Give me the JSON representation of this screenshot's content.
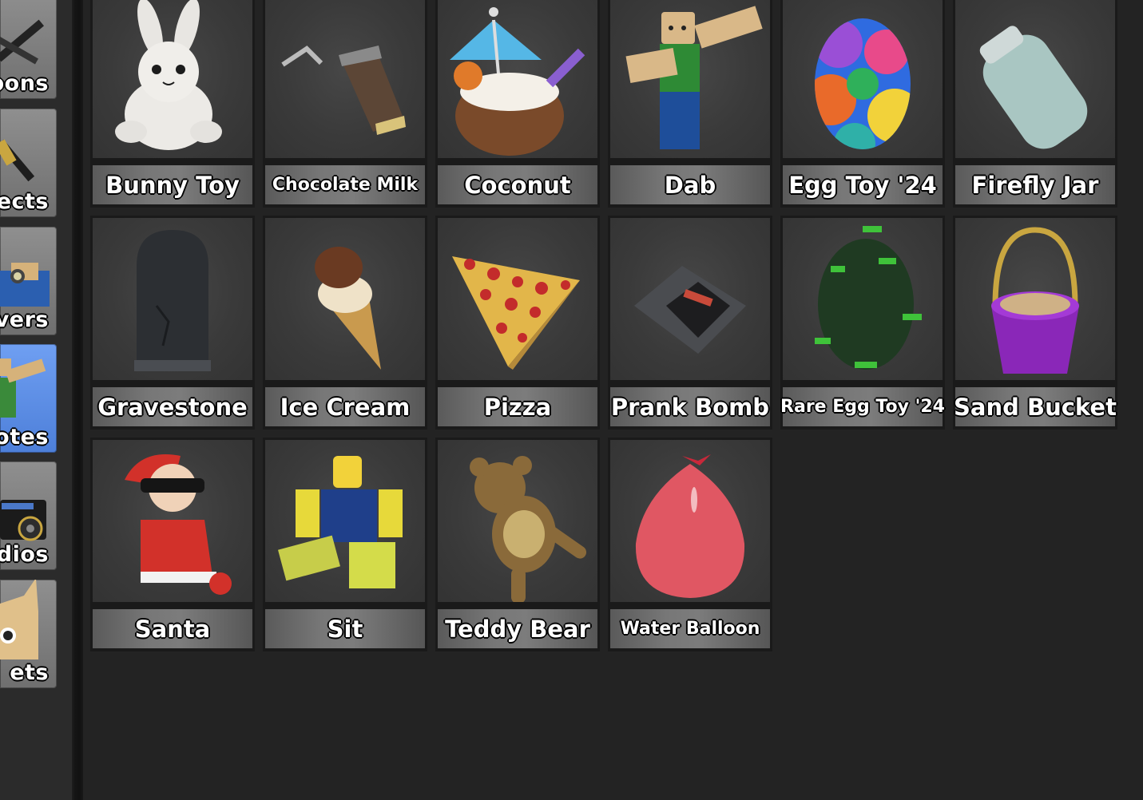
{
  "sidebar": {
    "categories": [
      {
        "label": "pons",
        "icon": "weapons-icon",
        "active": false
      },
      {
        "label": "ects",
        "icon": "effects-icon",
        "active": false
      },
      {
        "label": "vers",
        "icon": "powers-icon",
        "active": false
      },
      {
        "label": "otes",
        "icon": "emotes-icon",
        "active": true
      },
      {
        "label": "dios",
        "icon": "radios-icon",
        "active": false
      },
      {
        "label": "ets",
        "icon": "pets-icon",
        "active": false
      }
    ]
  },
  "items": [
    {
      "label": "Bunny Toy",
      "icon": "bunny-toy-icon"
    },
    {
      "label": "Chocolate Milk",
      "icon": "chocolate-milk-icon"
    },
    {
      "label": "Coconut",
      "icon": "coconut-icon"
    },
    {
      "label": "Dab",
      "icon": "dab-icon"
    },
    {
      "label": "Egg Toy '24",
      "icon": "egg-toy-icon"
    },
    {
      "label": "Firefly Jar",
      "icon": "firefly-jar-icon"
    },
    {
      "label": "Gravestone",
      "icon": "gravestone-icon"
    },
    {
      "label": "Ice Cream",
      "icon": "ice-cream-icon"
    },
    {
      "label": "Pizza",
      "icon": "pizza-icon"
    },
    {
      "label": "Prank Bomb",
      "icon": "prank-bomb-icon"
    },
    {
      "label": "Rare Egg Toy '24",
      "icon": "rare-egg-toy-icon"
    },
    {
      "label": "Sand Bucket",
      "icon": "sand-bucket-icon"
    },
    {
      "label": "Santa",
      "icon": "santa-icon"
    },
    {
      "label": "Sit",
      "icon": "sit-icon"
    },
    {
      "label": "Teddy Bear",
      "icon": "teddy-bear-icon"
    },
    {
      "label": "Water Balloon",
      "icon": "water-balloon-icon"
    }
  ],
  "colors": {
    "background": "#232323",
    "active_tab": "#5b8ce6",
    "inactive_tab": "#7d7d7d",
    "label_bar": "#707070"
  }
}
